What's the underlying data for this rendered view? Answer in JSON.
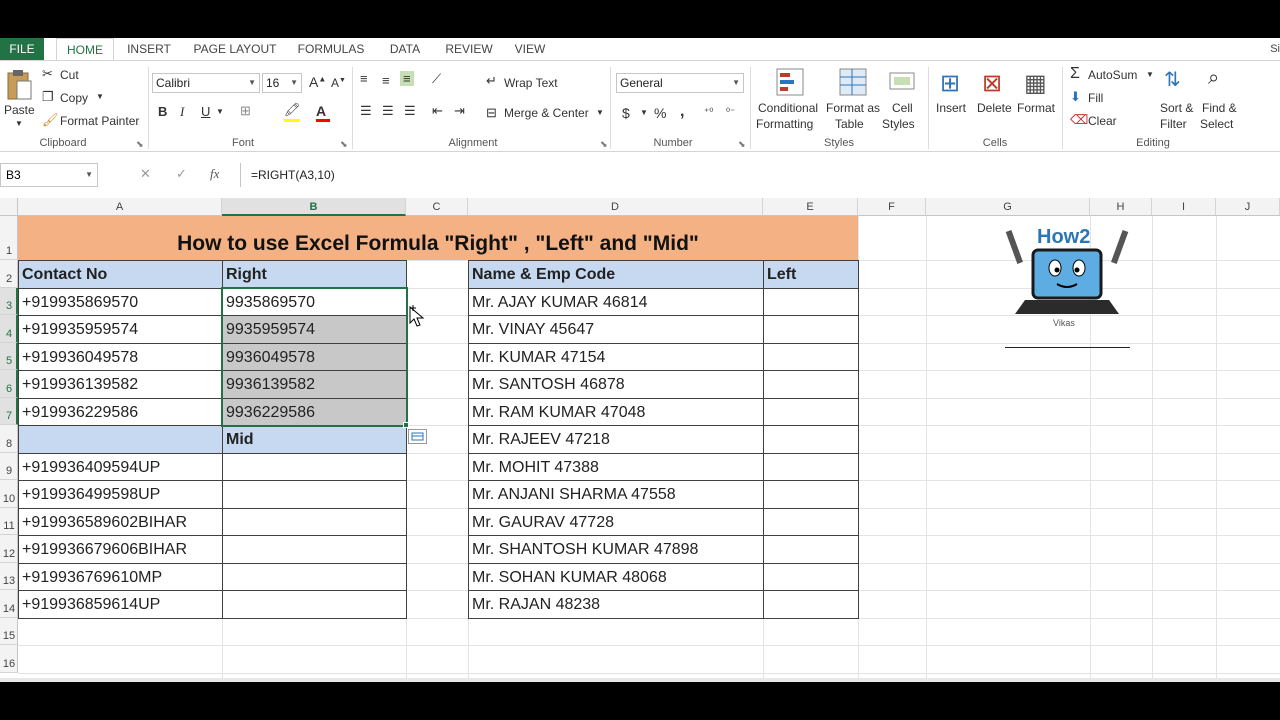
{
  "ribbon": {
    "tabs": [
      "FILE",
      "HOME",
      "INSERT",
      "PAGE LAYOUT",
      "FORMULAS",
      "DATA",
      "REVIEW",
      "VIEW"
    ],
    "active_tab": "HOME",
    "signin": "Si",
    "clipboard": {
      "label": "Clipboard",
      "paste": "Paste",
      "cut": "Cut",
      "copy": "Copy",
      "format_painter": "Format Painter"
    },
    "font": {
      "label": "Font",
      "name": "Calibri",
      "size": "16",
      "bold": "B",
      "italic": "I",
      "underline": "U"
    },
    "alignment": {
      "label": "Alignment",
      "wrap_text": "Wrap Text",
      "merge_center": "Merge & Center"
    },
    "number": {
      "label": "Number",
      "format": "General",
      "currency": "$",
      "percent": "%",
      "comma": ","
    },
    "styles": {
      "label": "Styles",
      "conditional": [
        "Conditional",
        "Formatting"
      ],
      "format_table": [
        "Format as",
        "Table"
      ],
      "cell_styles": [
        "Cell",
        "Styles"
      ]
    },
    "cells": {
      "label": "Cells",
      "insert": "Insert",
      "delete": "Delete",
      "format": "Format"
    },
    "editing": {
      "label": "Editing",
      "autosum": "AutoSum",
      "fill": "Fill",
      "clear": "Clear",
      "sort_filter": [
        "Sort &",
        "Filter"
      ],
      "find_select": [
        "Find &",
        "Select"
      ]
    }
  },
  "formula_bar": {
    "name_box": "B3",
    "formula": "=RIGHT(A3,10)"
  },
  "columns": [
    "A",
    "B",
    "C",
    "D",
    "E",
    "F",
    "G",
    "H",
    "I",
    "J"
  ],
  "rows": [
    "1",
    "2",
    "3",
    "4",
    "5",
    "6",
    "7",
    "8",
    "9",
    "10",
    "11",
    "12",
    "13",
    "14",
    "15",
    "16"
  ],
  "sheet": {
    "title": "How to use Excel Formula \"Right\" , \"Left\" and \"Mid\"",
    "headers": {
      "contact": "Contact No",
      "right": "Right",
      "mid": "Mid",
      "name_code": "Name & Emp Code",
      "left": "Left"
    },
    "contacts_top": [
      "+919935869570",
      "+919935959574",
      "+919936049578",
      "+919936139582",
      "+919936229586"
    ],
    "right_values": [
      "9935869570",
      "9935959574",
      "9936049578",
      "9936139582",
      "9936229586"
    ],
    "contacts_bottom": [
      "+919936409594UP",
      "+919936499598UP",
      "+919936589602BIHAR",
      "+919936679606BIHAR",
      "+919936769610MP",
      "+919936859614UP"
    ],
    "names": [
      "Mr. AJAY KUMAR 46814",
      "Mr. VINAY 45647",
      "Mr. KUMAR 47154",
      "Mr. SANTOSH 46878",
      "Mr. RAM KUMAR 47048",
      "Mr. RAJEEV 47218",
      "Mr. MOHIT 47388",
      "Mr. ANJANI SHARMA 47558",
      "Mr. GAURAV 47728",
      "Mr. SHANTOSH KUMAR 47898",
      "Mr. SOHAN KUMAR 48068",
      "Mr. RAJAN 48238"
    ]
  },
  "logo": {
    "text": "How2",
    "sub": "Vikas"
  },
  "colors": {
    "excel_green": "#217346",
    "title_fill": "#f4b183",
    "header_fill": "#c6d9f1",
    "selection_shade": "#c8c8c8"
  }
}
